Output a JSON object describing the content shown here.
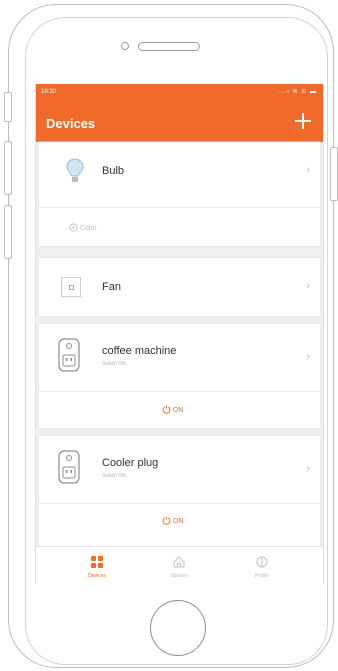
{
  "colors": {
    "accent": "#f06a2a",
    "text": "#333333",
    "muted": "#b3b3b3"
  },
  "status_bar": {
    "time": "10:30",
    "icons": "...‹ ≋ ⊙ ▬"
  },
  "app_bar": {
    "title": "Devices",
    "add_icon": "plus-icon"
  },
  "devices": [
    {
      "name": "Bulb",
      "icon": "bulb-icon",
      "action": {
        "label": "Color",
        "icon": "palette-icon"
      }
    },
    {
      "name": "Fan",
      "icon": "fan-icon"
    },
    {
      "name": "coffee machine",
      "status": "Switch ON",
      "icon": "smart-plug-icon",
      "action": {
        "label": "ON",
        "icon": "power-icon"
      }
    },
    {
      "name": "Cooler plug",
      "status": "Switch ON",
      "icon": "smart-plug-icon",
      "action": {
        "label": "ON",
        "icon": "power-icon"
      }
    }
  ],
  "tab_bar": {
    "tabs": [
      {
        "label": "Devices",
        "icon": "grid-icon",
        "active": true
      },
      {
        "label": "Scenes",
        "icon": "home-icon",
        "active": false
      },
      {
        "label": "Profile",
        "icon": "profile-icon",
        "active": false
      }
    ]
  }
}
